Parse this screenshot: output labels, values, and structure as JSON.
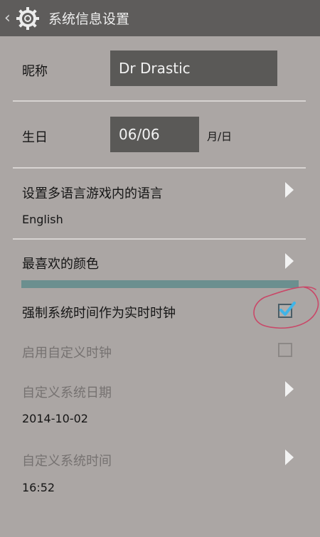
{
  "titlebar": {
    "back": "‹",
    "title": "系统信息设置"
  },
  "nickname": {
    "label": "昵称",
    "value": "Dr Drastic"
  },
  "birthday": {
    "label": "生日",
    "value": "06/06",
    "unit": "月/日"
  },
  "language": {
    "label": "设置多语言游戏内的语言",
    "value": "English"
  },
  "favorite_color": {
    "label": "最喜欢的颜色",
    "color": "#6b8f8f"
  },
  "force_system_time": {
    "label": "强制系统时间作为实时时钟",
    "checked": true
  },
  "custom_clock": {
    "label": "启用自定义时钟",
    "checked": false
  },
  "custom_date": {
    "label": "自定义系统日期",
    "value": "2014-10-02"
  },
  "custom_time": {
    "label": "自定义系统时间",
    "value": "16:52"
  }
}
